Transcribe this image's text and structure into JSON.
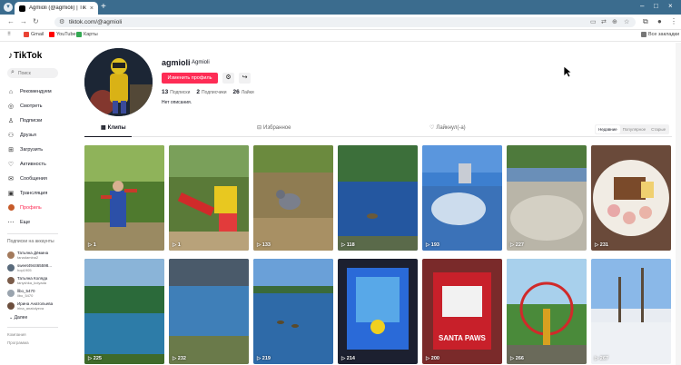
{
  "browser": {
    "tab_title": "Agmioli (@agmioli) | TikTok",
    "tab_close": "×",
    "new_tab": "+",
    "url": "tiktok.com/@agmioli",
    "bookmarks": [
      "Gmail",
      "YouTube",
      "Карты"
    ],
    "all_bookmarks": "Все закладки",
    "window_controls": [
      "–",
      "□",
      "×"
    ]
  },
  "sidebar": {
    "logo": "TikTok",
    "search_placeholder": "Поиск",
    "nav": [
      {
        "label": "Рекомендуем",
        "icon": "home-icon"
      },
      {
        "label": "Смотреть",
        "icon": "compass-icon"
      },
      {
        "label": "Подписки",
        "icon": "following-icon"
      },
      {
        "label": "Друзья",
        "icon": "friends-icon"
      },
      {
        "label": "Загрузить",
        "icon": "upload-icon"
      },
      {
        "label": "Активность",
        "icon": "activity-icon"
      },
      {
        "label": "Сообщения",
        "icon": "messages-icon"
      },
      {
        "label": "Трансляция",
        "icon": "live-icon"
      },
      {
        "label": "Профиль",
        "icon": "profile-avatar"
      },
      {
        "label": "Еще",
        "icon": "more-icon"
      }
    ],
    "following_title": "Подписки на аккаунты",
    "following": [
      {
        "name": "Татьяна Дёмина",
        "handle": "tanadamina2"
      },
      {
        "name": "sweet494465598...",
        "handle": "hop1905"
      },
      {
        "name": "Татьяна Коляда",
        "handle": "tanyshka_kolyada"
      },
      {
        "name": "llbo_5470",
        "handle": "llbo_5470"
      },
      {
        "name": "Ирина Анатольева",
        "handle": "irina_anatolyeva"
      }
    ],
    "more": "Далее",
    "footer": [
      "Компания",
      "Программа"
    ]
  },
  "profile": {
    "username": "agmioli",
    "nickname": "Agmioli",
    "edit_button": "Изменить профиль",
    "stats": [
      {
        "value": "13",
        "label": "Подписки"
      },
      {
        "value": "2",
        "label": "Подписчики"
      },
      {
        "value": "26",
        "label": "Лайки"
      }
    ],
    "bio": "Нет описания."
  },
  "tabs": [
    {
      "label": "Клипы",
      "icon": "grid-icon"
    },
    {
      "label": "Избранное",
      "icon": "bookmark-icon"
    },
    {
      "label": "Лайкнул(-а)",
      "icon": "heart-icon"
    }
  ],
  "sort": [
    "Недавние",
    "Популярное",
    "Старые"
  ],
  "videos": [
    {
      "views": "1",
      "scene": "costume-figure-park"
    },
    {
      "views": "1",
      "scene": "playground-slide"
    },
    {
      "views": "133",
      "scene": "pigeon-ground"
    },
    {
      "views": "118",
      "scene": "lake-duck"
    },
    {
      "views": "193",
      "scene": "fountain"
    },
    {
      "views": "227",
      "scene": "stony-riverbank"
    },
    {
      "views": "231",
      "scene": "food-plate"
    },
    {
      "views": "225",
      "scene": "forest-lake"
    },
    {
      "views": "232",
      "scene": "bridge-river"
    },
    {
      "views": "219",
      "scene": "ducks-pond"
    },
    {
      "views": "214",
      "scene": "arcade-machine"
    },
    {
      "views": "200",
      "scene": "santa-paws-bag"
    },
    {
      "views": "266",
      "scene": "ferris-wheel"
    },
    {
      "views": "267",
      "scene": "snowy-park"
    }
  ]
}
